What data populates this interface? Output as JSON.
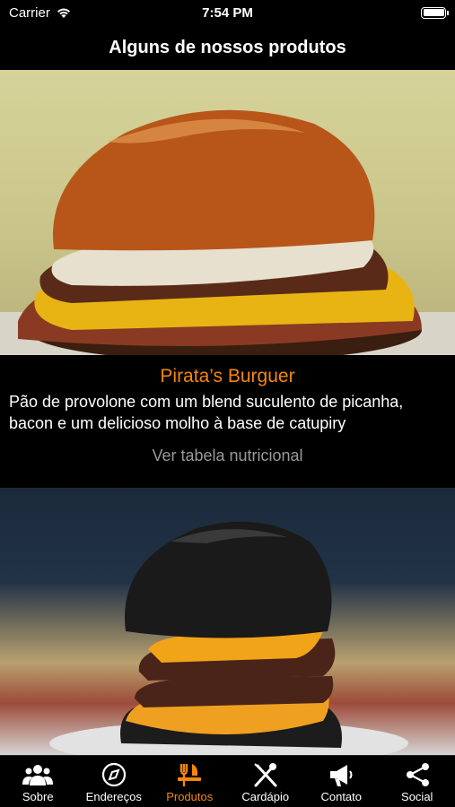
{
  "status": {
    "carrier": "Carrier",
    "time": "7:54 PM"
  },
  "header": {
    "title": "Alguns de nossos produtos"
  },
  "products": [
    {
      "name": "Pirata’s Burguer",
      "description": "Pão de provolone com um blend suculento de picanha, bacon e um delicioso molho à base de catupiry",
      "nutrition_link": "Ver tabela nutricional"
    }
  ],
  "tabs": [
    {
      "label": "Sobre",
      "icon": "people-icon",
      "active": false
    },
    {
      "label": "Endereços",
      "icon": "compass-icon",
      "active": false
    },
    {
      "label": "Produtos",
      "icon": "fork-knife-icon",
      "active": true
    },
    {
      "label": "Cardápio",
      "icon": "crossed-utensils-icon",
      "active": false
    },
    {
      "label": "Contato",
      "icon": "megaphone-icon",
      "active": false
    },
    {
      "label": "Social",
      "icon": "share-icon",
      "active": false
    }
  ],
  "colors": {
    "accent": "#f5870a",
    "background": "#000000",
    "muted": "#9a9a9a"
  }
}
